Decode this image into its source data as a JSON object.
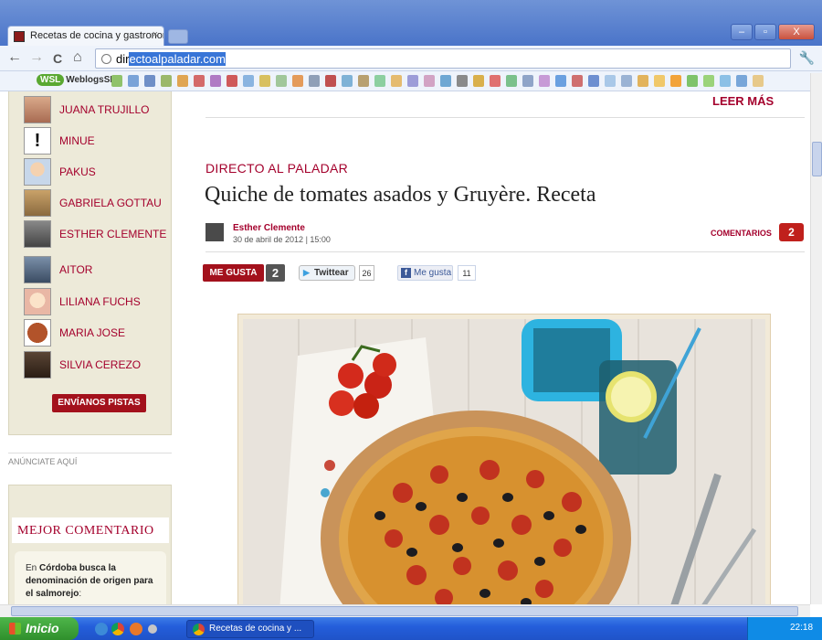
{
  "browser": {
    "tab_title": "Recetas de cocina y gastronom",
    "tab_close": "×",
    "url_prefix": "dir",
    "url_selected": "ectoalpaladar.com",
    "nav": {
      "back": "←",
      "forward": "→",
      "reload": "C",
      "home": "⌂"
    },
    "window_buttons": {
      "minimize": "–",
      "maximize": "▫",
      "close": "X"
    },
    "bookmarks_logo": "WSL",
    "bookmarks_label": "WeblogsSL"
  },
  "sidebar": {
    "authors": [
      {
        "name": "JUANA TRUJILLO"
      },
      {
        "name": "MINUE"
      },
      {
        "name": "PAKUS"
      },
      {
        "name": "GABRIELA GOTTAU"
      },
      {
        "name": "ESTHER CLEMENTE"
      },
      {
        "name": "AITOR"
      },
      {
        "name": "LILIANA FUCHS"
      },
      {
        "name": "MARIA JOSE"
      },
      {
        "name": "SILVIA CEREZO"
      }
    ],
    "pistas_button": "ENVÍANOS PISTAS",
    "anunciate": "ANÚNCIATE AQUÍ",
    "best_comment": {
      "title": "MEJOR COMENTARIO",
      "prefix": "En ",
      "link": "Córdoba busca la denominación de origen para el salmorejo",
      "suffix": ":"
    }
  },
  "article": {
    "leer_mas": "LEER MÁS",
    "section": "DIRECTO AL PALADAR",
    "title": "Quiche de tomates asados y Gruyère. Receta",
    "author": "Esther Clemente",
    "date": "30 de abril de 2012 | 15:00",
    "comments_label": "COMENTARIOS",
    "comments_count": "2",
    "social": {
      "megusta_label": "ME GUSTA",
      "megusta_count": "2",
      "twitter_label": "Twittear",
      "twitter_count": "26",
      "facebook_label": "Me gusta",
      "facebook_count": "11"
    }
  },
  "taskbar": {
    "start": "Inicio",
    "task": "Recetas de cocina y ...",
    "clock": "22:18"
  },
  "colors": {
    "brand_red": "#a4002c",
    "sidebar_bg": "#edead9",
    "taskbar_blue": "#245edb"
  }
}
